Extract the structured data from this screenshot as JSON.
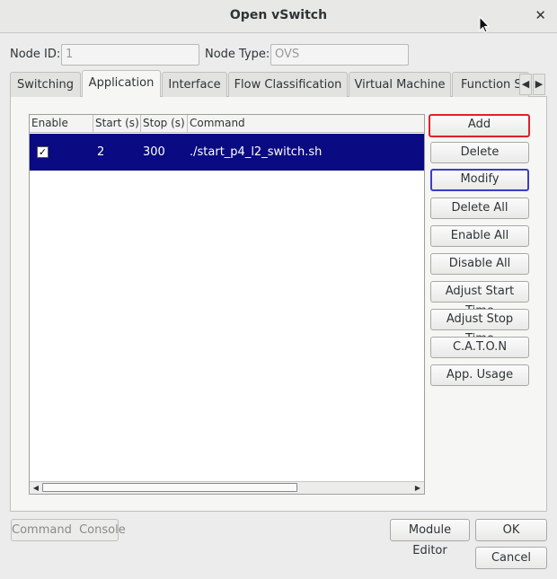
{
  "window": {
    "title": "Open vSwitch"
  },
  "header": {
    "node_id_label": "Node ID:",
    "node_id_value": "1",
    "node_type_label": "Node Type:",
    "node_type_value": "OVS"
  },
  "tabs": [
    {
      "label": "Switching"
    },
    {
      "label": "Application",
      "active": true
    },
    {
      "label": "Interface"
    },
    {
      "label": "Flow Classification"
    },
    {
      "label": "Virtual Machine"
    },
    {
      "label": "Function Sc"
    }
  ],
  "table": {
    "columns": [
      "Enable",
      "Start (s)",
      "Stop (s)",
      "Command"
    ],
    "rows": [
      {
        "enabled": true,
        "start": "2",
        "stop": "300",
        "command": "./start_p4_l2_switch.sh"
      }
    ]
  },
  "side_buttons": [
    "Add",
    "Delete",
    "Modify",
    "Delete All",
    "Enable All",
    "Disable All",
    "Adjust Start Time",
    "Adjust Stop Time",
    "C.A.T.O.N",
    "App. Usage"
  ],
  "footer": {
    "command_console": "Command  Console",
    "module_editor": "Module Editor",
    "ok": "OK",
    "cancel": "Cancel"
  },
  "colors": {
    "selected_row": "#0a0a82",
    "add_highlight": "#e0202a",
    "modify_highlight": "#3c3cc8"
  }
}
